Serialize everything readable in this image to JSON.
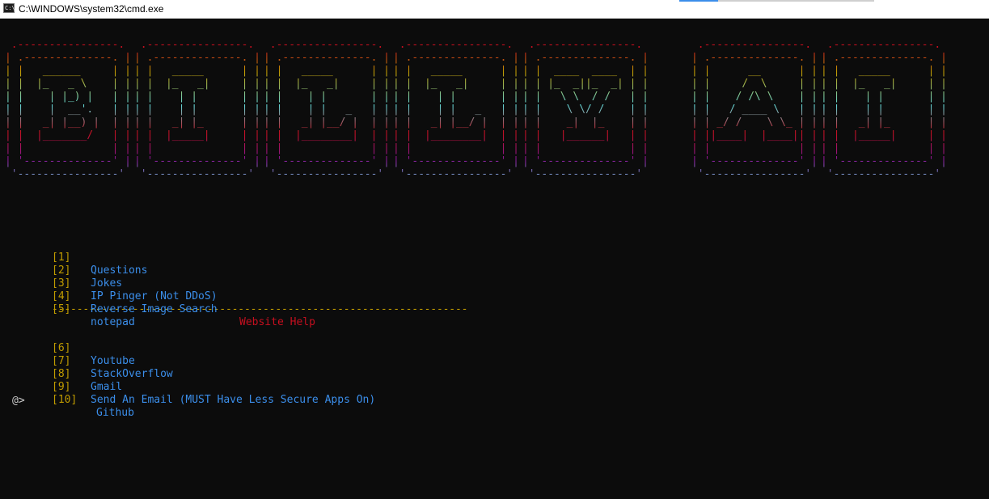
{
  "window": {
    "title": "C:\\WINDOWS\\system32\\cmd.exe",
    "icon_name": "console-app-icon",
    "icon_glyph": "C:\\"
  },
  "colors": {
    "background": "#0c0c0c",
    "number": "#c19c00",
    "option": "#3b8eea",
    "header": "#c50f1f",
    "prompt": "#cccccc",
    "logo_gradient": [
      "#c50f1f",
      "#c19c00",
      "#61d6d6",
      "#881798"
    ]
  },
  "banner": {
    "letters": [
      "B",
      "I",
      "L",
      "L",
      "Y",
      "A",
      "I"
    ]
  },
  "menu": {
    "options": [
      {
        "number": "[1]",
        "label": "Questions"
      },
      {
        "number": "[2]",
        "label": "Jokes"
      },
      {
        "number": "[3]",
        "label": "IP Pinger (Not DDoS)"
      },
      {
        "number": "[4]",
        "label": "Reverse Image Search"
      },
      {
        "number": "[5]",
        "label": "notepad"
      }
    ],
    "separator": "-------------------------------------------------------------------",
    "section_header": "Website Help",
    "web_options": [
      {
        "number": "[6]",
        "label": "Youtube"
      },
      {
        "number": "[7]",
        "label": "StackOverflow"
      },
      {
        "number": "[8]",
        "label": "Gmail"
      },
      {
        "number": "[9]",
        "label": "Send An Email (MUST Have Less Secure Apps On)"
      },
      {
        "number": "[10]",
        "label": "Github"
      }
    ]
  },
  "prompt": {
    "text": "@>"
  }
}
